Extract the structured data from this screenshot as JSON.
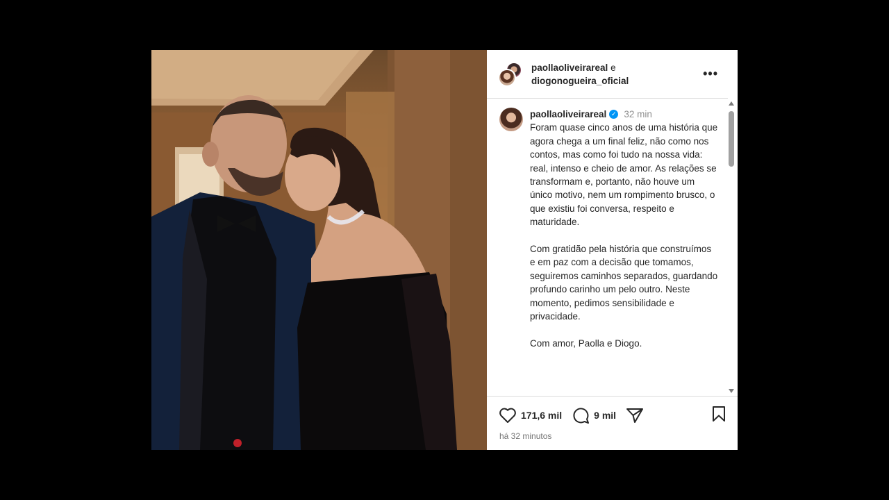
{
  "post": {
    "authors": {
      "user1": "paollaoliveirareal",
      "conjunction": "e",
      "user2": "diogonogueira_oficial"
    },
    "more_options": "•••",
    "caption": {
      "username": "paollaoliveirareal",
      "verified": true,
      "time": "32 min",
      "paragraphs": [
        "Foram quase cinco anos de uma história que agora chega a um final feliz, não como nos contos, mas como foi tudo na nossa vida: real, intenso e cheio de amor. As relações se transformam e, portanto, não houve um único motivo, nem um rompimento brusco, o que existiu foi conversa, respeito e maturidade.",
        "Com gratidão pela história que construímos e em paz com a decisão que tomamos, seguiremos caminhos separados, guardando profundo carinho um pelo outro. Neste momento, pedimos sensibilidade e privacidade.",
        "Com amor, Paolla e Diogo."
      ]
    },
    "actions": {
      "likes": "171,6 mil",
      "comments": "9 mil",
      "like_icon": "heart-icon",
      "comment_icon": "comment-icon",
      "share_icon": "share-icon",
      "save_icon": "bookmark-icon"
    },
    "timestamp": "há 32 minutos",
    "colors": {
      "verified": "#0095f6",
      "background": "#000000",
      "panel": "#ffffff"
    }
  }
}
